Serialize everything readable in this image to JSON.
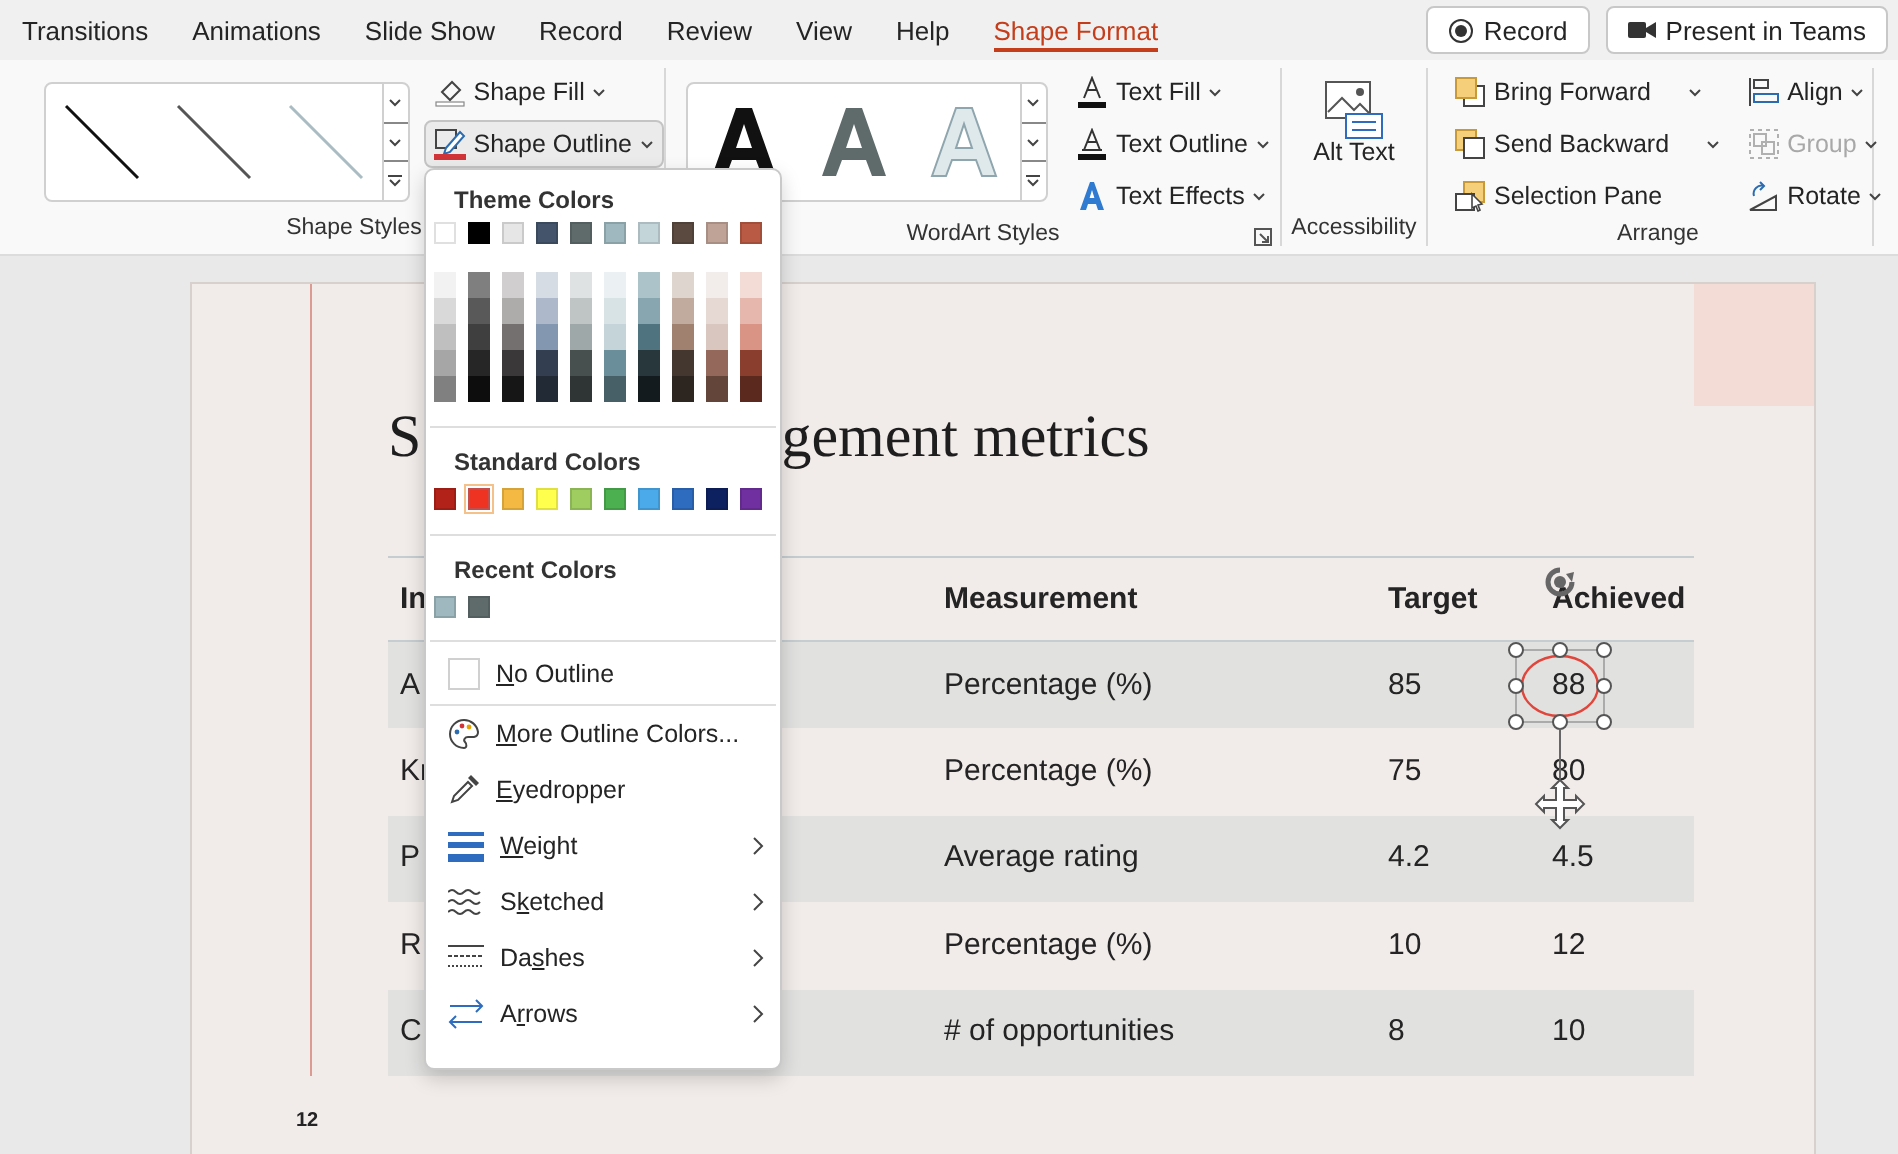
{
  "ribbon_tabs": [
    {
      "label": "Transitions",
      "selected": false
    },
    {
      "label": "Animations",
      "selected": false
    },
    {
      "label": "Slide Show",
      "selected": false
    },
    {
      "label": "Record",
      "selected": false
    },
    {
      "label": "Review",
      "selected": false
    },
    {
      "label": "View",
      "selected": false
    },
    {
      "label": "Help",
      "selected": false
    },
    {
      "label": "Shape Format",
      "selected": true
    }
  ],
  "title_buttons": [
    {
      "label": "Record",
      "kind": "record"
    },
    {
      "label": "Present in Teams",
      "kind": "teams"
    }
  ],
  "shape_styles": {
    "label": "Shape Styles",
    "buttons": [
      {
        "label": "Shape Fill",
        "kind": "fill",
        "expanded": false
      },
      {
        "label": "Shape Outline",
        "kind": "outline",
        "expanded": true
      }
    ]
  },
  "wordart_styles": {
    "label": "WordArt Styles",
    "buttons": [
      {
        "label": "Text Fill",
        "kind": "fill"
      },
      {
        "label": "Text Outline",
        "kind": "outline"
      },
      {
        "label": "Text Effects",
        "kind": "effects"
      }
    ]
  },
  "accessibility": {
    "label": "Accessibility",
    "button": "Alt Text"
  },
  "arrange": {
    "label": "Arrange",
    "buttons": [
      {
        "label": "Bring Forward",
        "kind": "forward",
        "disabled": false
      },
      {
        "label": "Send Backward",
        "kind": "backward",
        "disabled": false
      },
      {
        "label": "Selection Pane",
        "kind": "pane",
        "disabled": false
      },
      {
        "label": "Align",
        "kind": "align",
        "disabled": false
      },
      {
        "label": "Group",
        "kind": "group",
        "disabled": true
      },
      {
        "label": "Rotate",
        "kind": "rotate",
        "disabled": false
      }
    ]
  },
  "slide": {
    "title_start": "S",
    "title_end": "gement metrics",
    "page_number": "12",
    "table": {
      "columns": [
        "In",
        "Measurement",
        "Target",
        "Achieved"
      ],
      "rows": [
        {
          "cells": [
            "A",
            "Percentage (%)",
            "85",
            "88"
          ]
        },
        {
          "cells": [
            "Kr",
            "Percentage (%)",
            "75",
            "80"
          ]
        },
        {
          "cells": [
            "P",
            "Average rating",
            "4.2",
            "4.5"
          ]
        },
        {
          "cells": [
            "R",
            "Percentage (%)",
            "10",
            "12"
          ]
        },
        {
          "cells": [
            "C",
            "# of opportunities",
            "8",
            "10"
          ]
        }
      ]
    }
  },
  "outline_menu": {
    "theme_heading": "Theme Colors",
    "theme_colors": [
      {
        "color": "#ffffff",
        "shades": [
          {
            "color": "#f2f2f2"
          },
          {
            "color": "#d9d9d9"
          },
          {
            "color": "#bfbfbf"
          },
          {
            "color": "#a6a6a6"
          },
          {
            "color": "#808080"
          }
        ]
      },
      {
        "color": "#000000",
        "shades": [
          {
            "color": "#7f7f7f"
          },
          {
            "color": "#595959"
          },
          {
            "color": "#3f3f3f"
          },
          {
            "color": "#262626"
          },
          {
            "color": "#0d0d0d"
          }
        ]
      },
      {
        "color": "#e7e6e6",
        "shades": [
          {
            "color": "#d0cece"
          },
          {
            "color": "#aeabab"
          },
          {
            "color": "#757070"
          },
          {
            "color": "#3a3838"
          },
          {
            "color": "#171616"
          }
        ]
      },
      {
        "color": "#44546a",
        "shades": [
          {
            "color": "#d6dce4"
          },
          {
            "color": "#adb9ca"
          },
          {
            "color": "#8497b0"
          },
          {
            "color": "#333f50"
          },
          {
            "color": "#222a35"
          }
        ]
      },
      {
        "color": "#5f6b6b",
        "shades": [
          {
            "color": "#dfe2e2"
          },
          {
            "color": "#bfc5c5"
          },
          {
            "color": "#9fa8a8"
          },
          {
            "color": "#474f4f"
          },
          {
            "color": "#2f3535"
          }
        ]
      },
      {
        "color": "#9fb8c0",
        "shades": [
          {
            "color": "#ebf0f2"
          },
          {
            "color": "#d8e3e6"
          },
          {
            "color": "#c5d4d9"
          },
          {
            "color": "#6b8f9a"
          },
          {
            "color": "#475f66"
          }
        ]
      },
      {
        "color": "#c4d5da",
        "shades": [
          {
            "color": "#adc3ca"
          },
          {
            "color": "#87a6b0"
          },
          {
            "color": "#4f7480"
          },
          {
            "color": "#27373c"
          },
          {
            "color": "#131b1e"
          }
        ]
      },
      {
        "color": "#5a4a3f",
        "shades": [
          {
            "color": "#ded5cf"
          },
          {
            "color": "#c0ab9e"
          },
          {
            "color": "#a0806e"
          },
          {
            "color": "#43372f"
          },
          {
            "color": "#2d251f"
          }
        ]
      },
      {
        "color": "#bfa396",
        "shades": [
          {
            "color": "#f2ecea"
          },
          {
            "color": "#e6d9d4"
          },
          {
            "color": "#d9c6bf"
          },
          {
            "color": "#94695b"
          },
          {
            "color": "#634639"
          }
        ]
      },
      {
        "color": "#b85a44",
        "shades": [
          {
            "color": "#f3dcd6"
          },
          {
            "color": "#e6b8ad"
          },
          {
            "color": "#d99485"
          },
          {
            "color": "#8a3e2d"
          },
          {
            "color": "#5c291e"
          }
        ]
      }
    ],
    "standard_heading": "Standard Colors",
    "standard_colors": [
      {
        "color": "#b22219",
        "selected": false
      },
      {
        "color": "#ee3322",
        "selected": true
      },
      {
        "color": "#f4b942",
        "selected": false
      },
      {
        "color": "#ffff4d",
        "selected": false
      },
      {
        "color": "#9fcd60",
        "selected": false
      },
      {
        "color": "#4caf50",
        "selected": false
      },
      {
        "color": "#4baaea",
        "selected": false
      },
      {
        "color": "#2e6cbf",
        "selected": false
      },
      {
        "color": "#0d2160",
        "selected": false
      },
      {
        "color": "#7030a0",
        "selected": false
      }
    ],
    "recent_heading": "Recent Colors",
    "recent_colors": [
      {
        "color": "#9fb8c0"
      },
      {
        "color": "#5f6b6b"
      }
    ],
    "items": [
      {
        "kind": "no-outline",
        "key": "N",
        "rest": "o Outline",
        "submenu": false
      },
      {
        "kind": "more-colors",
        "key": "M",
        "rest": "ore Outline Colors...",
        "submenu": false
      },
      {
        "kind": "eyedropper",
        "key": "E",
        "rest": "yedropper",
        "submenu": false
      },
      {
        "kind": "weight",
        "key": "W",
        "rest": "eight",
        "submenu": true
      },
      {
        "kind": "sketched",
        "lead": "S",
        "key": "k",
        "rest": "etched",
        "submenu": true
      },
      {
        "kind": "dashes",
        "lead": "Da",
        "key": "s",
        "rest": "hes",
        "submenu": true
      },
      {
        "kind": "arrows",
        "lead": "A",
        "key": "r",
        "rest": "rows",
        "submenu": true
      }
    ]
  }
}
